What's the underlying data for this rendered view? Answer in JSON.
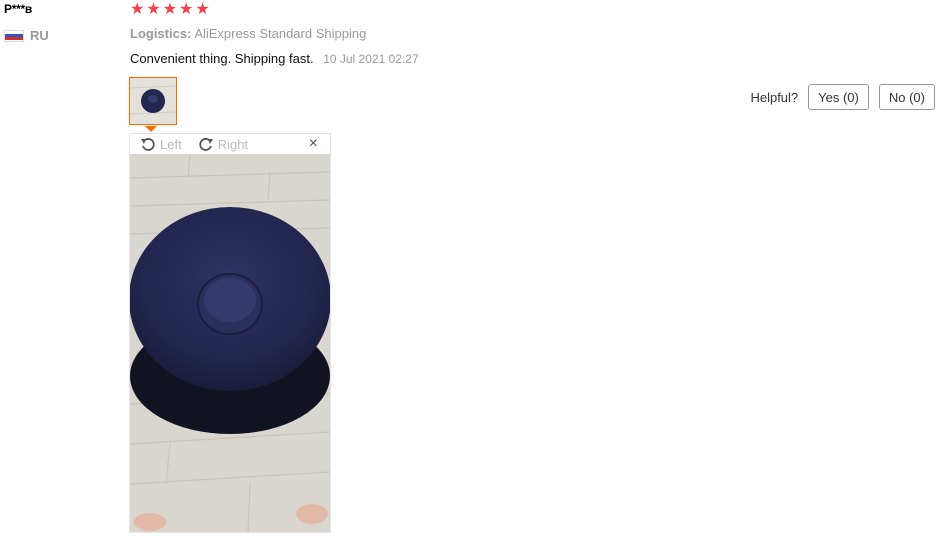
{
  "reviewer": {
    "name": "P***в",
    "country": "RU"
  },
  "rating": {
    "stars": 5
  },
  "logistics": {
    "label": "Logistics:",
    "value": "AliExpress Standard Shipping"
  },
  "review": {
    "text": "Convenient thing. Shipping fast.",
    "date": "10 Jul 2021 02:27"
  },
  "helpful": {
    "label": "Helpful?",
    "yes": "Yes (0)",
    "no": "No (0)"
  },
  "viewer": {
    "rotate_left": "Left",
    "rotate_right": "Right",
    "close": "×"
  },
  "colors": {
    "star": "#f2404d",
    "accent": "#ff6a00",
    "muted": "#999999"
  },
  "icons": [
    "russia-flag-icon",
    "star-icon",
    "rotate-left-icon",
    "rotate-right-icon",
    "close-icon"
  ]
}
